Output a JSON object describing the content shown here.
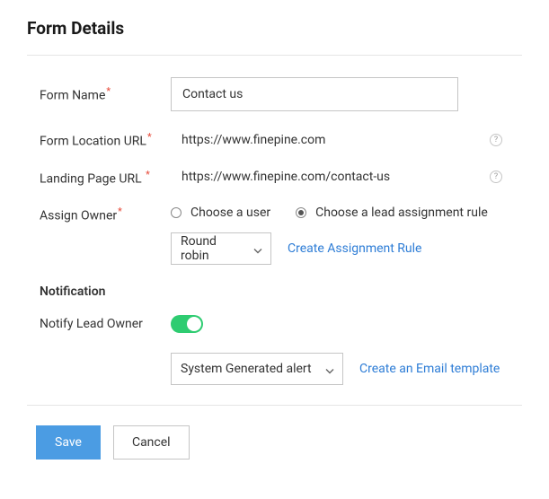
{
  "page": {
    "title": "Form Details"
  },
  "fields": {
    "formName": {
      "label": "Form Name",
      "value": "Contact us"
    },
    "formLocationUrl": {
      "label": "Form Location URL",
      "value": "https://www.finepine.com"
    },
    "landingPageUrl": {
      "label": "Landing Page URL",
      "value": "https://www.finepine.com/contact-us"
    },
    "assignOwner": {
      "label": "Assign Owner",
      "options": {
        "chooseUser": "Choose a user",
        "chooseRule": "Choose a lead assignment rule"
      },
      "selected": "chooseRule",
      "ruleSelect": "Round robin",
      "createRuleLink": "Create Assignment Rule"
    }
  },
  "notification": {
    "sectionLabel": "Notification",
    "notifyLeadOwner": {
      "label": "Notify Lead Owner",
      "enabled": true
    },
    "alertSelect": "System Generated alert",
    "createTemplateLink": "Create an Email template"
  },
  "buttons": {
    "save": "Save",
    "cancel": "Cancel"
  },
  "icons": {
    "help": "?"
  }
}
